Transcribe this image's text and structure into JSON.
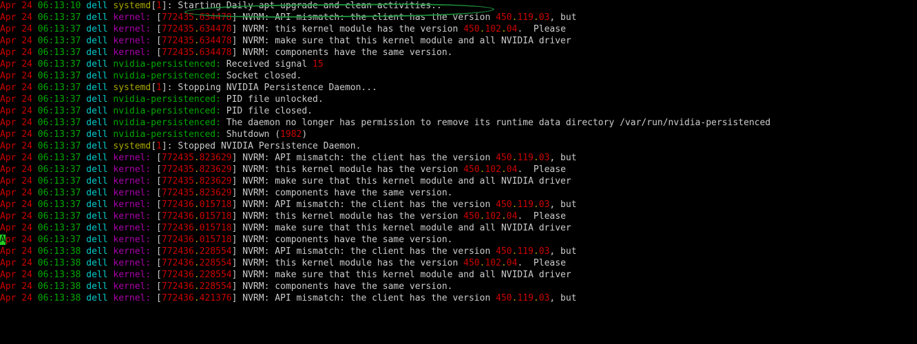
{
  "host": "dell",
  "lines": [
    {
      "date": "Apr 24",
      "time": "06:13:10",
      "svc": "systemd",
      "svc_cls": "svc",
      "pid": "1",
      "kts": null,
      "msg": "Starting Daily apt upgrade and clean activities..",
      "hl": true
    },
    {
      "date": "Apr 24",
      "time": "06:13:37",
      "svc": "kernel:",
      "svc_cls": "svc-knl",
      "pid": null,
      "kts": [
        "772435",
        "634478"
      ],
      "msg": "NVRM: API mismatch: the client has the version ",
      "v1": "450",
      "v1b": "119",
      "v1c": "03",
      "tail": ", but"
    },
    {
      "date": "Apr 24",
      "time": "06:13:37",
      "svc": "kernel:",
      "svc_cls": "svc-knl",
      "pid": null,
      "kts": [
        "772435",
        "634478"
      ],
      "msg": "NVRM: this kernel module has the version ",
      "v1": "450",
      "v1b": "102",
      "v1c": "04",
      "tail": ".  Please"
    },
    {
      "date": "Apr 24",
      "time": "06:13:37",
      "svc": "kernel:",
      "svc_cls": "svc-knl",
      "pid": null,
      "kts": [
        "772435",
        "634478"
      ],
      "msg": "NVRM: make sure that this kernel module and all NVIDIA driver"
    },
    {
      "date": "Apr 24",
      "time": "06:13:37",
      "svc": "kernel:",
      "svc_cls": "svc-knl",
      "pid": null,
      "kts": [
        "772435",
        "634478"
      ],
      "msg": "NVRM: components have the same version."
    },
    {
      "date": "Apr 24",
      "time": "06:13:37",
      "svc": "nvidia-persistenced:",
      "svc_cls": "svc-nv",
      "pid": null,
      "kts": null,
      "msg": "Received signal ",
      "num": "15"
    },
    {
      "date": "Apr 24",
      "time": "06:13:37",
      "svc": "nvidia-persistenced:",
      "svc_cls": "svc-nv",
      "pid": null,
      "kts": null,
      "msg": "Socket closed."
    },
    {
      "date": "Apr 24",
      "time": "06:13:37",
      "svc": "systemd",
      "svc_cls": "svc",
      "pid": "1",
      "kts": null,
      "msg": "Stopping NVIDIA Persistence Daemon..."
    },
    {
      "date": "Apr 24",
      "time": "06:13:37",
      "svc": "nvidia-persistenced:",
      "svc_cls": "svc-nv",
      "pid": null,
      "kts": null,
      "msg": "PID file unlocked."
    },
    {
      "date": "Apr 24",
      "time": "06:13:37",
      "svc": "nvidia-persistenced:",
      "svc_cls": "svc-nv",
      "pid": null,
      "kts": null,
      "msg": "PID file closed."
    },
    {
      "date": "Apr 24",
      "time": "06:13:37",
      "svc": "nvidia-persistenced:",
      "svc_cls": "svc-nv",
      "pid": null,
      "kts": null,
      "msg": "The daemon no longer has permission to remove its runtime data directory /var/run/nvidia-persistenced"
    },
    {
      "date": "Apr 24",
      "time": "06:13:37",
      "svc": "nvidia-persistenced:",
      "svc_cls": "svc-nv",
      "pid": null,
      "kts": null,
      "msg": "Shutdown (",
      "num": "1982",
      "tail": ")"
    },
    {
      "date": "Apr 24",
      "time": "06:13:37",
      "svc": "systemd",
      "svc_cls": "svc",
      "pid": "1",
      "kts": null,
      "msg": "Stopped NVIDIA Persistence Daemon."
    },
    {
      "date": "Apr 24",
      "time": "06:13:37",
      "svc": "kernel:",
      "svc_cls": "svc-knl",
      "pid": null,
      "kts": [
        "772435",
        "823629"
      ],
      "msg": "NVRM: API mismatch: the client has the version ",
      "v1": "450",
      "v1b": "119",
      "v1c": "03",
      "tail": ", but"
    },
    {
      "date": "Apr 24",
      "time": "06:13:37",
      "svc": "kernel:",
      "svc_cls": "svc-knl",
      "pid": null,
      "kts": [
        "772435",
        "823629"
      ],
      "msg": "NVRM: this kernel module has the version ",
      "v1": "450",
      "v1b": "102",
      "v1c": "04",
      "tail": ".  Please"
    },
    {
      "date": "Apr 24",
      "time": "06:13:37",
      "svc": "kernel:",
      "svc_cls": "svc-knl",
      "pid": null,
      "kts": [
        "772435",
        "823629"
      ],
      "msg": "NVRM: make sure that this kernel module and all NVIDIA driver"
    },
    {
      "date": "Apr 24",
      "time": "06:13:37",
      "svc": "kernel:",
      "svc_cls": "svc-knl",
      "pid": null,
      "kts": [
        "772435",
        "823629"
      ],
      "msg": "NVRM: components have the same version."
    },
    {
      "date": "Apr 24",
      "time": "06:13:37",
      "svc": "kernel:",
      "svc_cls": "svc-knl",
      "pid": null,
      "kts": [
        "772436",
        "015718"
      ],
      "msg": "NVRM: API mismatch: the client has the version ",
      "v1": "450",
      "v1b": "119",
      "v1c": "03",
      "tail": ", but"
    },
    {
      "date": "Apr 24",
      "time": "06:13:37",
      "svc": "kernel:",
      "svc_cls": "svc-knl",
      "pid": null,
      "kts": [
        "772436",
        "015718"
      ],
      "msg": "NVRM: this kernel module has the version ",
      "v1": "450",
      "v1b": "102",
      "v1c": "04",
      "tail": ".  Please"
    },
    {
      "date": "Apr 24",
      "time": "06:13:37",
      "svc": "kernel:",
      "svc_cls": "svc-knl",
      "pid": null,
      "kts": [
        "772436",
        "015718"
      ],
      "msg": "NVRM: make sure that this kernel module and all NVIDIA driver"
    },
    {
      "date": "Apr 24",
      "time": "06:13:37",
      "svc": "kernel:",
      "svc_cls": "svc-knl",
      "pid": null,
      "kts": [
        "772436",
        "015718"
      ],
      "msg": "NVRM: components have the same version.",
      "cursor": true
    },
    {
      "date": "Apr 24",
      "time": "06:13:38",
      "svc": "kernel:",
      "svc_cls": "svc-knl",
      "pid": null,
      "kts": [
        "772436",
        "228554"
      ],
      "msg": "NVRM: API mismatch: the client has the version ",
      "v1": "450",
      "v1b": "119",
      "v1c": "03",
      "tail": ", but"
    },
    {
      "date": "Apr 24",
      "time": "06:13:38",
      "svc": "kernel:",
      "svc_cls": "svc-knl",
      "pid": null,
      "kts": [
        "772436",
        "228554"
      ],
      "msg": "NVRM: this kernel module has the version ",
      "v1": "450",
      "v1b": "102",
      "v1c": "04",
      "tail": ".  Please"
    },
    {
      "date": "Apr 24",
      "time": "06:13:38",
      "svc": "kernel:",
      "svc_cls": "svc-knl",
      "pid": null,
      "kts": [
        "772436",
        "228554"
      ],
      "msg": "NVRM: make sure that this kernel module and all NVIDIA driver"
    },
    {
      "date": "Apr 24",
      "time": "06:13:38",
      "svc": "kernel:",
      "svc_cls": "svc-knl",
      "pid": null,
      "kts": [
        "772436",
        "228554"
      ],
      "msg": "NVRM: components have the same version."
    },
    {
      "date": "Apr 24",
      "time": "06:13:38",
      "svc": "kernel:",
      "svc_cls": "svc-knl",
      "pid": null,
      "kts": [
        "772436",
        "421376"
      ],
      "msg": "NVRM: API mismatch: the client has the version ",
      "v1": "450",
      "v1b": "119",
      "v1c": "03",
      "tail": ", but"
    }
  ]
}
